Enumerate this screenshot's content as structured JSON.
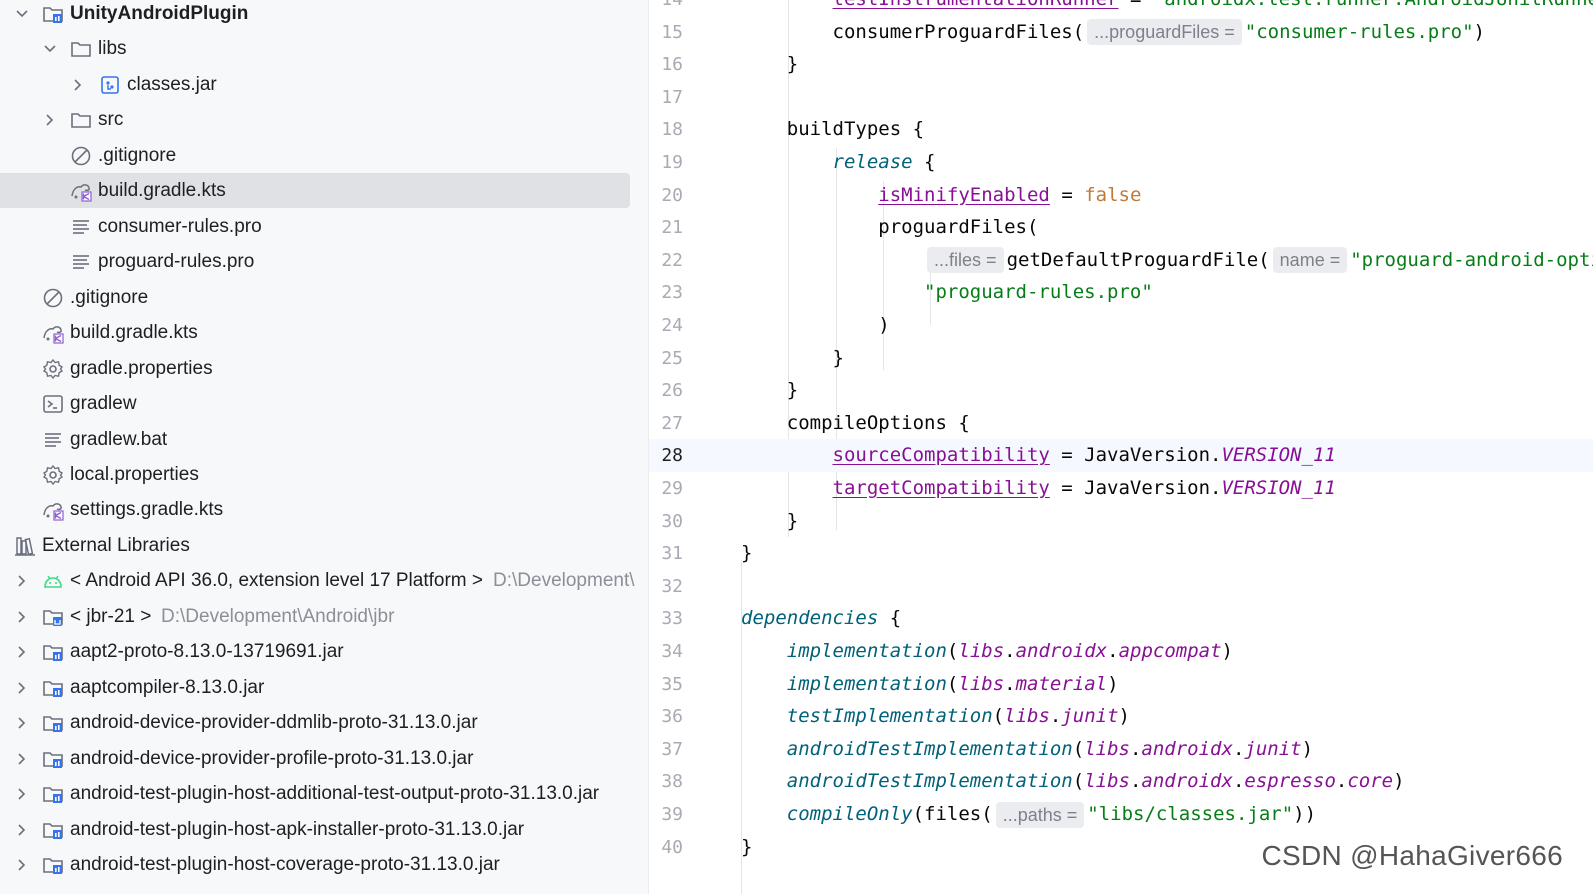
{
  "project_tree": {
    "items": [
      {
        "label": "UnityAndroidPlugin",
        "path": "",
        "icon": "module-folder-icon",
        "expanded": "open"
      },
      {
        "label": "libs",
        "path": "",
        "icon": "folder-icon",
        "expanded": "open"
      },
      {
        "label": "classes.jar",
        "path": "",
        "icon": "jar-icon",
        "expanded": "closed"
      },
      {
        "label": "src",
        "path": "",
        "icon": "folder-icon",
        "expanded": "closed"
      },
      {
        "label": ".gitignore",
        "path": "",
        "icon": "gitignore-icon",
        "expanded": ""
      },
      {
        "label": "build.gradle.kts",
        "path": "",
        "icon": "gradle-kts-icon",
        "expanded": ""
      },
      {
        "label": "consumer-rules.pro",
        "path": "",
        "icon": "text-file-icon",
        "expanded": ""
      },
      {
        "label": "proguard-rules.pro",
        "path": "",
        "icon": "text-file-icon",
        "expanded": ""
      },
      {
        "label": ".gitignore",
        "path": "",
        "icon": "gitignore-icon",
        "expanded": ""
      },
      {
        "label": "build.gradle.kts",
        "path": "",
        "icon": "gradle-kts-icon",
        "expanded": ""
      },
      {
        "label": "gradle.properties",
        "path": "",
        "icon": "gear-icon",
        "expanded": ""
      },
      {
        "label": "gradlew",
        "path": "",
        "icon": "terminal-icon",
        "expanded": ""
      },
      {
        "label": "gradlew.bat",
        "path": "",
        "icon": "text-file-icon",
        "expanded": ""
      },
      {
        "label": "local.properties",
        "path": "",
        "icon": "gear-icon",
        "expanded": ""
      },
      {
        "label": "settings.gradle.kts",
        "path": "",
        "icon": "gradle-kts-icon",
        "expanded": ""
      },
      {
        "label": "External Libraries",
        "path": "",
        "icon": "libraries-icon",
        "expanded": ""
      },
      {
        "label": "< Android API 36.0, extension level 17 Platform >",
        "path": "D:\\Development\\",
        "icon": "android-icon",
        "expanded": "closed"
      },
      {
        "label": "< jbr-21 >",
        "path": "D:\\Development\\Android\\jbr",
        "icon": "jdk-icon",
        "expanded": "closed"
      },
      {
        "label": "aapt2-proto-8.13.0-13719691.jar",
        "path": "",
        "icon": "library-jar-icon",
        "expanded": "closed"
      },
      {
        "label": "aaptcompiler-8.13.0.jar",
        "path": "",
        "icon": "library-jar-icon",
        "expanded": "closed"
      },
      {
        "label": "android-device-provider-ddmlib-proto-31.13.0.jar",
        "path": "",
        "icon": "library-jar-icon",
        "expanded": "closed"
      },
      {
        "label": "android-device-provider-profile-proto-31.13.0.jar",
        "path": "",
        "icon": "library-jar-icon",
        "expanded": "closed"
      },
      {
        "label": "android-test-plugin-host-additional-test-output-proto-31.13.0.jar",
        "path": "",
        "icon": "library-jar-icon",
        "expanded": "closed"
      },
      {
        "label": "android-test-plugin-host-apk-installer-proto-31.13.0.jar",
        "path": "",
        "icon": "library-jar-icon",
        "expanded": "closed"
      },
      {
        "label": "android-test-plugin-host-coverage-proto-31.13.0.jar",
        "path": "",
        "icon": "library-jar-icon",
        "expanded": "closed"
      }
    ],
    "selected_index": 5
  },
  "editor": {
    "current_line": "28",
    "lines": [
      {
        "n": "14",
        "html": "        <span class=\"prop\">testInstrumentationRunner</span> = <span class=\"str\">\"androidx.test.runner.AndroidJUnitRunner\"</span>"
      },
      {
        "n": "15",
        "html": "        consumerProguardFiles(<span class=\"hint\">...proguardFiles =</span><span class=\"str\">\"consumer-rules.pro\"</span>)"
      },
      {
        "n": "16",
        "html": "    }"
      },
      {
        "n": "17",
        "html": ""
      },
      {
        "n": "18",
        "html": "    buildTypes {"
      },
      {
        "n": "19",
        "html": "        <span class=\"rel\">release</span> {"
      },
      {
        "n": "20",
        "html": "            <span class=\"prop\">isMinifyEnabled</span> = <span class=\"bool\">false</span>"
      },
      {
        "n": "21",
        "html": "            proguardFiles("
      },
      {
        "n": "22",
        "html": "                <span class=\"hint\">...files =</span>getDefaultProguardFile(<span class=\"hint\">name =</span><span class=\"str\">\"proguard-android-optimize.txt\"</span>),"
      },
      {
        "n": "23",
        "html": "                <span class=\"str\">\"proguard-rules.pro\"</span>"
      },
      {
        "n": "24",
        "html": "            )"
      },
      {
        "n": "25",
        "html": "        }"
      },
      {
        "n": "26",
        "html": "    }"
      },
      {
        "n": "27",
        "html": "    compileOptions {"
      },
      {
        "n": "28",
        "html": "        <span class=\"prop\">sourceCompatibility</span> = JavaVersion.<span class=\"ital\">VERSION_11</span>"
      },
      {
        "n": "29",
        "html": "        <span class=\"prop\">targetCompatibility</span> = JavaVersion.<span class=\"ital\">VERSION_11</span>"
      },
      {
        "n": "30",
        "html": "    }"
      },
      {
        "n": "31",
        "html": "}"
      },
      {
        "n": "32",
        "html": ""
      },
      {
        "n": "33",
        "html": "<span class=\"dep\">dependencies</span> {"
      },
      {
        "n": "34",
        "html": "    <span class=\"fn\">implementation</span>(<span class=\"ital\">libs</span>.<span class=\"ital\">androidx</span>.<span class=\"ital\">appcompat</span>)"
      },
      {
        "n": "35",
        "html": "    <span class=\"fn\">implementation</span>(<span class=\"ital\">libs</span>.<span class=\"ital\">material</span>)"
      },
      {
        "n": "36",
        "html": "    <span class=\"fn\">testImplementation</span>(<span class=\"ital\">libs</span>.<span class=\"ital\">junit</span>)"
      },
      {
        "n": "37",
        "html": "    <span class=\"fn\">androidTestImplementation</span>(<span class=\"ital\">libs</span>.<span class=\"ital\">androidx</span>.<span class=\"ital\">junit</span>)"
      },
      {
        "n": "38",
        "html": "    <span class=\"fn\">androidTestImplementation</span>(<span class=\"ital\">libs</span>.<span class=\"ital\">androidx</span>.<span class=\"ital\">espresso</span>.<span class=\"ital\">core</span>)"
      },
      {
        "n": "39",
        "html": "    <span class=\"fn\">compileOnly</span>(files(<span class=\"hint\">...paths =</span><span class=\"str\">\"libs/classes.jar\"</span>))"
      },
      {
        "n": "40",
        "html": "}"
      }
    ]
  },
  "watermark": "CSDN @HahaGiver666",
  "colors": {
    "keyword": "#0033b3",
    "string": "#067d17",
    "property": "#871094",
    "function": "#00627a",
    "selection": "#dfe1e5",
    "bulb": "#f2c94c"
  }
}
